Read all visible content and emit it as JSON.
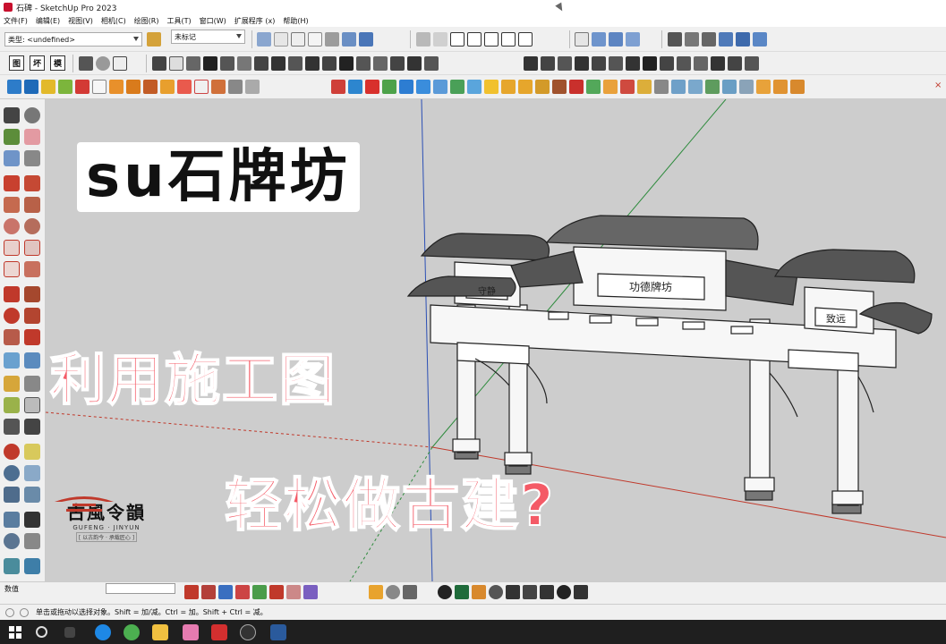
{
  "window": {
    "title": "石碑 - SketchUp Pro 2023"
  },
  "menu": [
    "文件(F)",
    "编辑(E)",
    "视图(V)",
    "相机(C)",
    "绘图(R)",
    "工具(T)",
    "窗口(W)",
    "扩展程序 (x)",
    "帮助(H)"
  ],
  "toolbar": {
    "type_dropdown_value": "类型: <undefined>",
    "tag_dropdown_value": "未标记",
    "frame_buttons": [
      "图",
      "坏",
      "模"
    ]
  },
  "overlay": {
    "title": "su石牌坊",
    "line1": "利用施工图",
    "line2": "轻松做古建?"
  },
  "model_plaques": {
    "center": "功德牌坊",
    "left": "守静",
    "right": "致远"
  },
  "logo": {
    "name": "古風令韻",
    "pinyin": "GUFENG · JINYUN",
    "tagline": "[ 以古韵今 · 承载匠心 ]"
  },
  "bottom": {
    "measure_label": "数值"
  },
  "status": {
    "hint": "单击或拖动以选择对象。Shift = 加/减。Ctrl = 加。Shift + Ctrl = 减。"
  },
  "colors": {
    "viewport": "#cdcdcd",
    "overlay_red": "#f45a66",
    "axis_red": "#c0392b",
    "axis_green": "#2e8b3d",
    "axis_blue": "#2b4fb5"
  }
}
